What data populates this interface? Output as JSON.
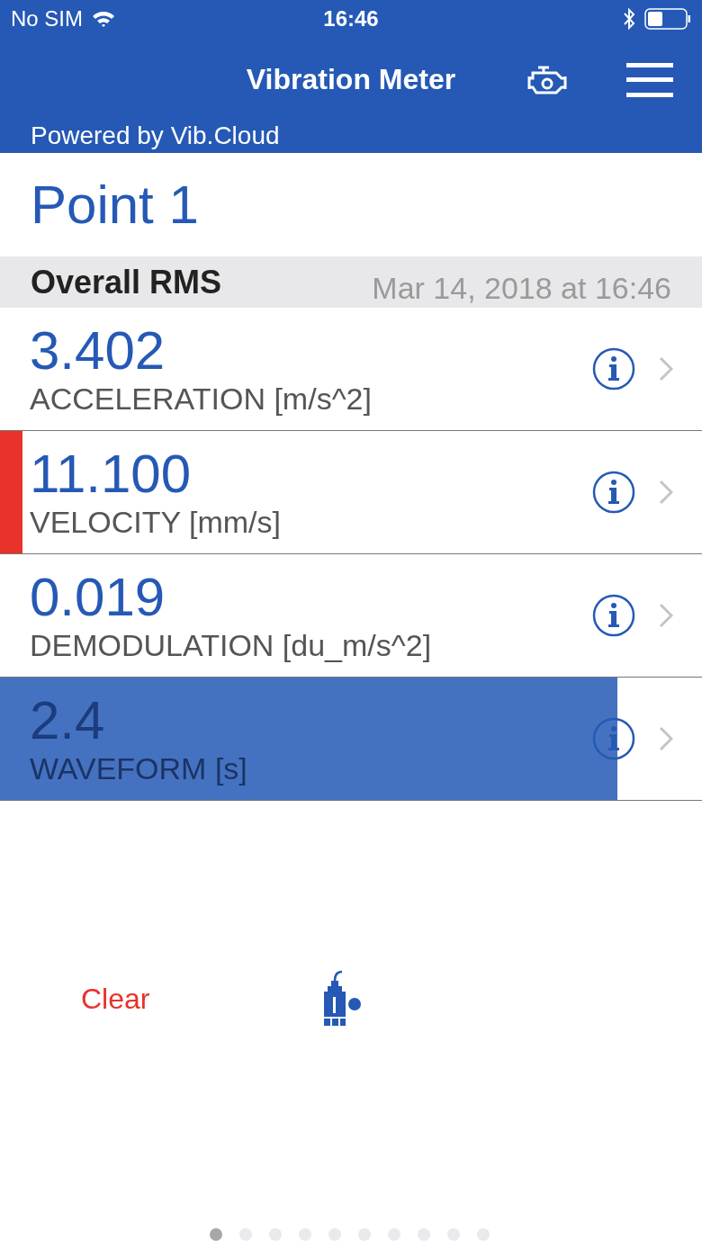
{
  "status_bar": {
    "carrier": "No SIM",
    "time": "16:46"
  },
  "nav": {
    "title": "Vibration Meter"
  },
  "powered_by": "Powered by Vib.Cloud",
  "point": {
    "title": "Point 1"
  },
  "section": {
    "title": "Overall RMS",
    "timestamp": "Mar 14, 2018 at 16:46"
  },
  "measurements": [
    {
      "value": "3.402",
      "label": "ACCELERATION [m/s^2]",
      "alarm": false
    },
    {
      "value": "11.100",
      "label": "VELOCITY [mm/s]",
      "alarm": true
    },
    {
      "value": "0.019",
      "label": "DEMODULATION [du_m/s^2]",
      "alarm": false
    },
    {
      "value": "2.4",
      "label": "WAVEFORM [s]",
      "alarm": false,
      "level": 0.88
    }
  ],
  "clear_button": "Clear",
  "pages": [
    {
      "selected": true
    },
    {
      "selected": false
    },
    {
      "selected": false
    },
    {
      "selected": false
    },
    {
      "selected": false
    },
    {
      "selected": false
    },
    {
      "selected": false
    },
    {
      "selected": false
    },
    {
      "selected": false
    },
    {
      "selected": false
    }
  ]
}
